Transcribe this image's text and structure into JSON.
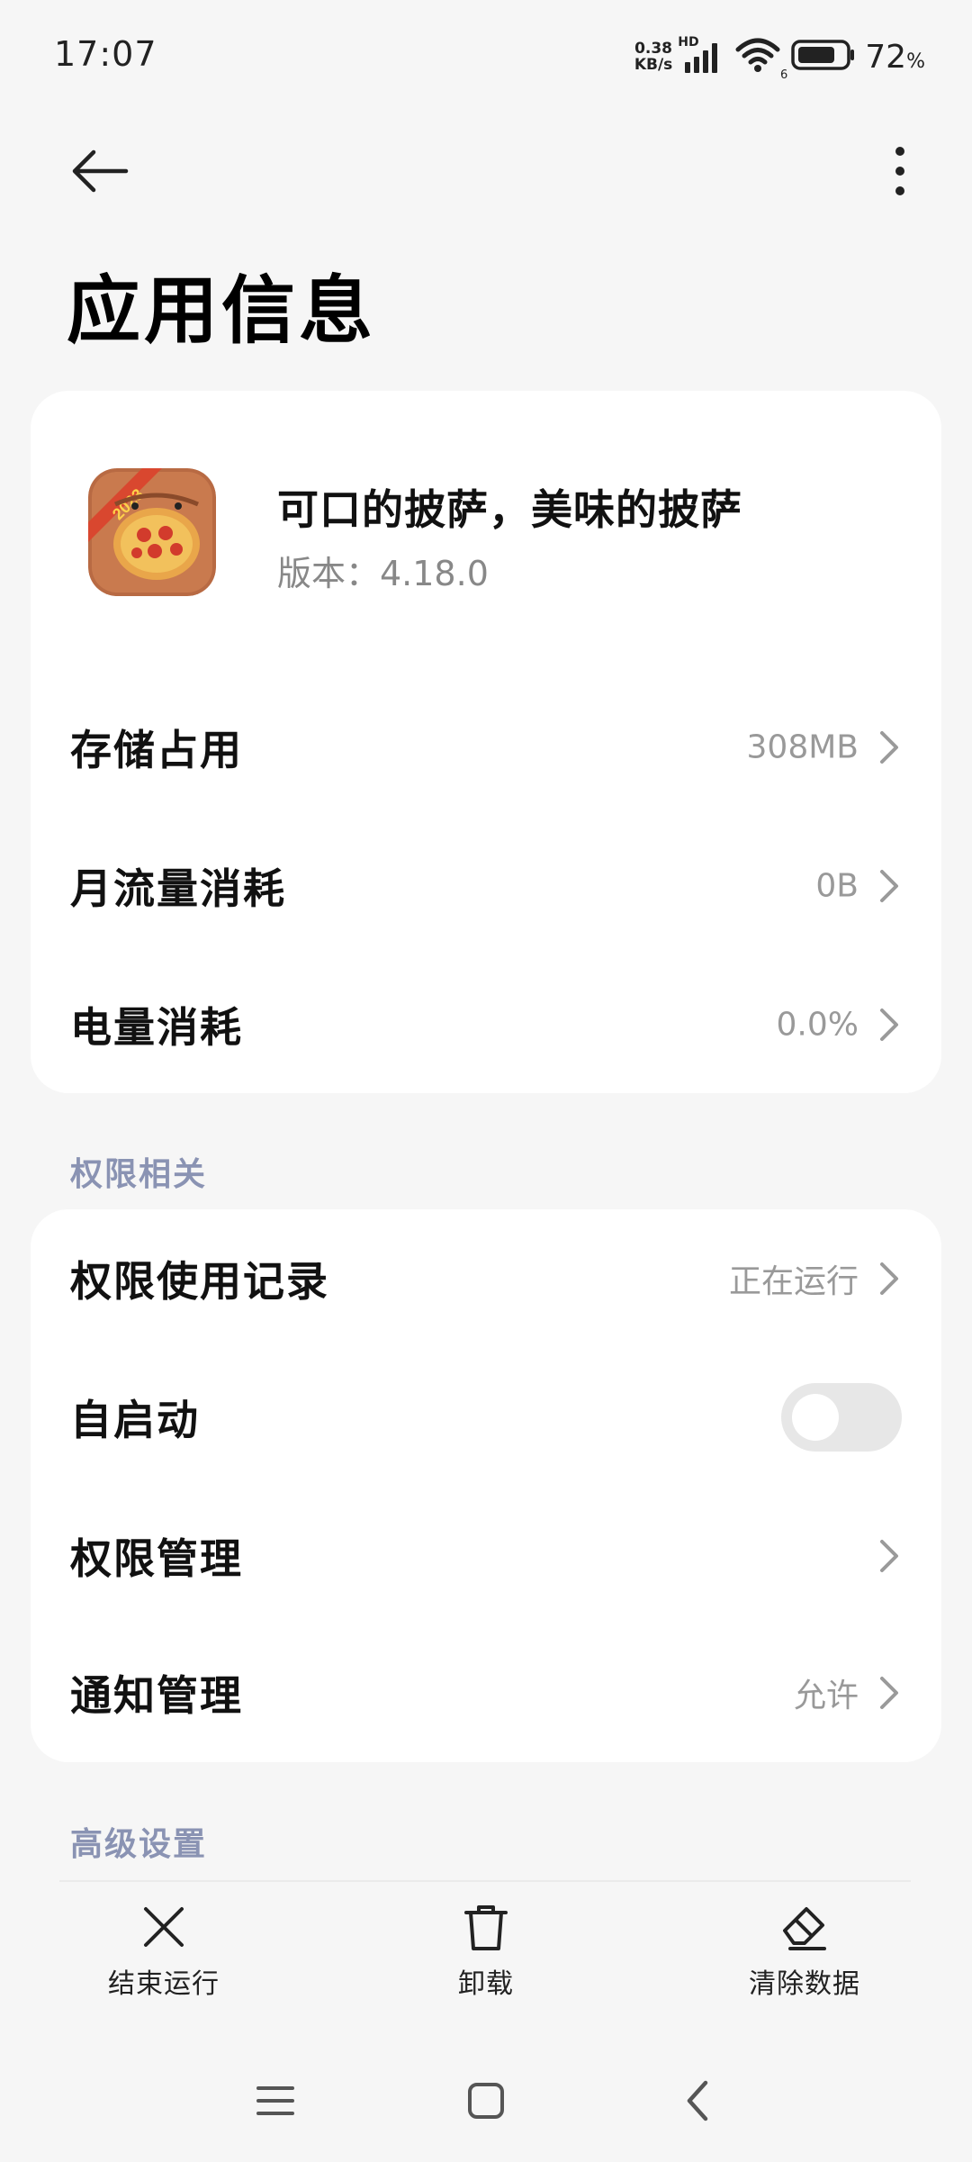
{
  "status_bar": {
    "time": "17:07",
    "net_speed_value": "0.38",
    "net_speed_unit": "KB/s",
    "network_type": "HD",
    "wifi_badge": "6",
    "battery_level": "72",
    "battery_unit": "%",
    "icons": [
      "signal-icon",
      "wifi-icon",
      "battery-icon"
    ]
  },
  "toolbar": {
    "back_icon": "arrow-left-icon",
    "more_icon": "more-vertical-icon"
  },
  "page": {
    "title": "应用信息"
  },
  "app": {
    "name": "可口的披萨，美味的披萨",
    "version": "版本：4.18.0",
    "icon": "pizza-app-icon"
  },
  "usage_rows": [
    {
      "label": "存储占用",
      "value": "308MB"
    },
    {
      "label": "月流量消耗",
      "value": "0B"
    },
    {
      "label": "电量消耗",
      "value": "0.0%"
    }
  ],
  "sections": {
    "permissions_title": "权限相关",
    "advanced_title": "高级设置"
  },
  "permission_rows": [
    {
      "label": "权限使用记录",
      "value": "正在运行"
    },
    {
      "label": "自启动",
      "toggle_on": false
    },
    {
      "label": "权限管理",
      "value": ""
    },
    {
      "label": "通知管理",
      "value": "允许"
    }
  ],
  "actions": [
    {
      "label": "结束运行",
      "icon": "close-icon"
    },
    {
      "label": "卸载",
      "icon": "trash-icon"
    },
    {
      "label": "清除数据",
      "icon": "eraser-icon"
    }
  ],
  "nav_bar": {
    "icons": [
      "menu-icon",
      "home-square-icon",
      "back-chevron-icon"
    ]
  },
  "colors": {
    "background": "#f6f6f6",
    "card": "#ffffff",
    "section_title": "#8a93b3",
    "secondary_text": "#999999",
    "toggle_off": "#e7e7e7"
  }
}
